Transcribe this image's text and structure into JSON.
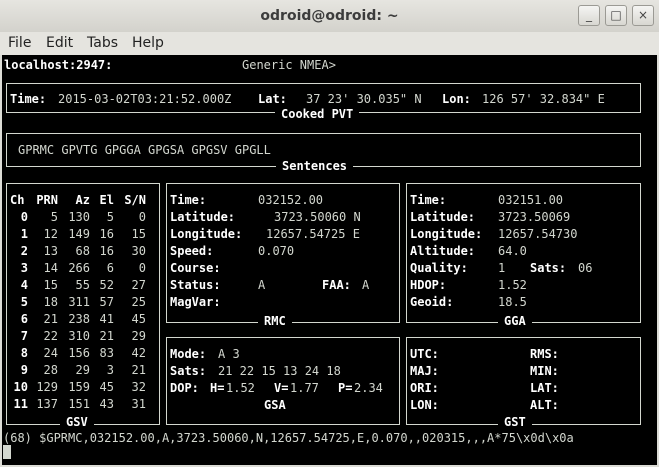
{
  "window": {
    "title": "odroid@odroid: ~",
    "buttons": [
      "_",
      "□",
      "×"
    ]
  },
  "menu": [
    "File",
    "Edit",
    "Tabs",
    "Help"
  ],
  "header": {
    "host": "localhost:2947:",
    "device": "Generic NMEA>"
  },
  "pvt": {
    "caption": "Cooked PVT",
    "time_label": "Time:",
    "time": "2015-03-02T03:21:52.000Z",
    "lat_label": "Lat:",
    "lat": "37 23' 30.035\" N",
    "lon_label": "Lon:",
    "lon": "126 57' 32.834\" E"
  },
  "sentences": {
    "caption": "Sentences",
    "list": "GPRMC GPVTG GPGGA GPGSA GPGSV GPGLL"
  },
  "gsv": {
    "caption": "GSV",
    "headers": [
      "Ch",
      "PRN",
      "Az",
      "El",
      "S/N"
    ],
    "rows": [
      [
        "0",
        "5",
        "130",
        "5",
        "0"
      ],
      [
        "1",
        "12",
        "149",
        "16",
        "15"
      ],
      [
        "2",
        "13",
        "68",
        "16",
        "30"
      ],
      [
        "3",
        "14",
        "266",
        "6",
        "0"
      ],
      [
        "4",
        "15",
        "55",
        "52",
        "27"
      ],
      [
        "5",
        "18",
        "311",
        "57",
        "25"
      ],
      [
        "6",
        "21",
        "238",
        "41",
        "45"
      ],
      [
        "7",
        "22",
        "310",
        "21",
        "29"
      ],
      [
        "8",
        "24",
        "156",
        "83",
        "42"
      ],
      [
        "9",
        "28",
        "29",
        "3",
        "21"
      ],
      [
        "10",
        "129",
        "159",
        "45",
        "32"
      ],
      [
        "11",
        "137",
        "151",
        "43",
        "31"
      ]
    ]
  },
  "rmc": {
    "caption": "RMC",
    "time_label": "Time:",
    "time": "032152.00",
    "lat_label": "Latitude:",
    "lat": "3723.50060 N",
    "lon_label": "Longitude:",
    "lon": "12657.54725 E",
    "speed_label": "Speed:",
    "speed": "0.070",
    "course_label": "Course:",
    "course": "",
    "status_label": "Status:",
    "status": "A",
    "faa_label": "FAA:",
    "faa": "A",
    "magvar_label": "MagVar:",
    "magvar": ""
  },
  "gga": {
    "caption": "GGA",
    "time_label": "Time:",
    "time": "032151.00",
    "lat_label": "Latitude:",
    "lat": "3723.50069",
    "lon_label": "Longitude:",
    "lon": "12657.54730",
    "alt_label": "Altitude:",
    "alt": "64.0",
    "quality_label": "Quality:",
    "quality": "1",
    "sats_label": "Sats:",
    "sats": "06",
    "hdop_label": "HDOP:",
    "hdop": "1.52",
    "geoid_label": "Geoid:",
    "geoid": "18.5"
  },
  "gsa": {
    "caption": "GSA",
    "mode_label": "Mode:",
    "mode": "A 3",
    "sats_label": "Sats:",
    "sats": "21 22 15 13 24 18",
    "dop_label": "DOP:",
    "h_label": "H=",
    "h": "1.52",
    "v_label": "V=",
    "v": "1.77",
    "p_label": "P=",
    "p": "2.34"
  },
  "gst": {
    "caption": "GST",
    "utc_label": "UTC:",
    "rms_label": "RMS:",
    "maj_label": "MAJ:",
    "min_label": "MIN:",
    "ori_label": "ORI:",
    "lat_label": "LAT:",
    "lon_label": "LON:",
    "alt_label": "ALT:"
  },
  "raw_line": "(68) $GPRMC,032152.00,A,3723.50060,N,12657.54725,E,0.070,,020315,,,A*75\\x0d\\x0a"
}
